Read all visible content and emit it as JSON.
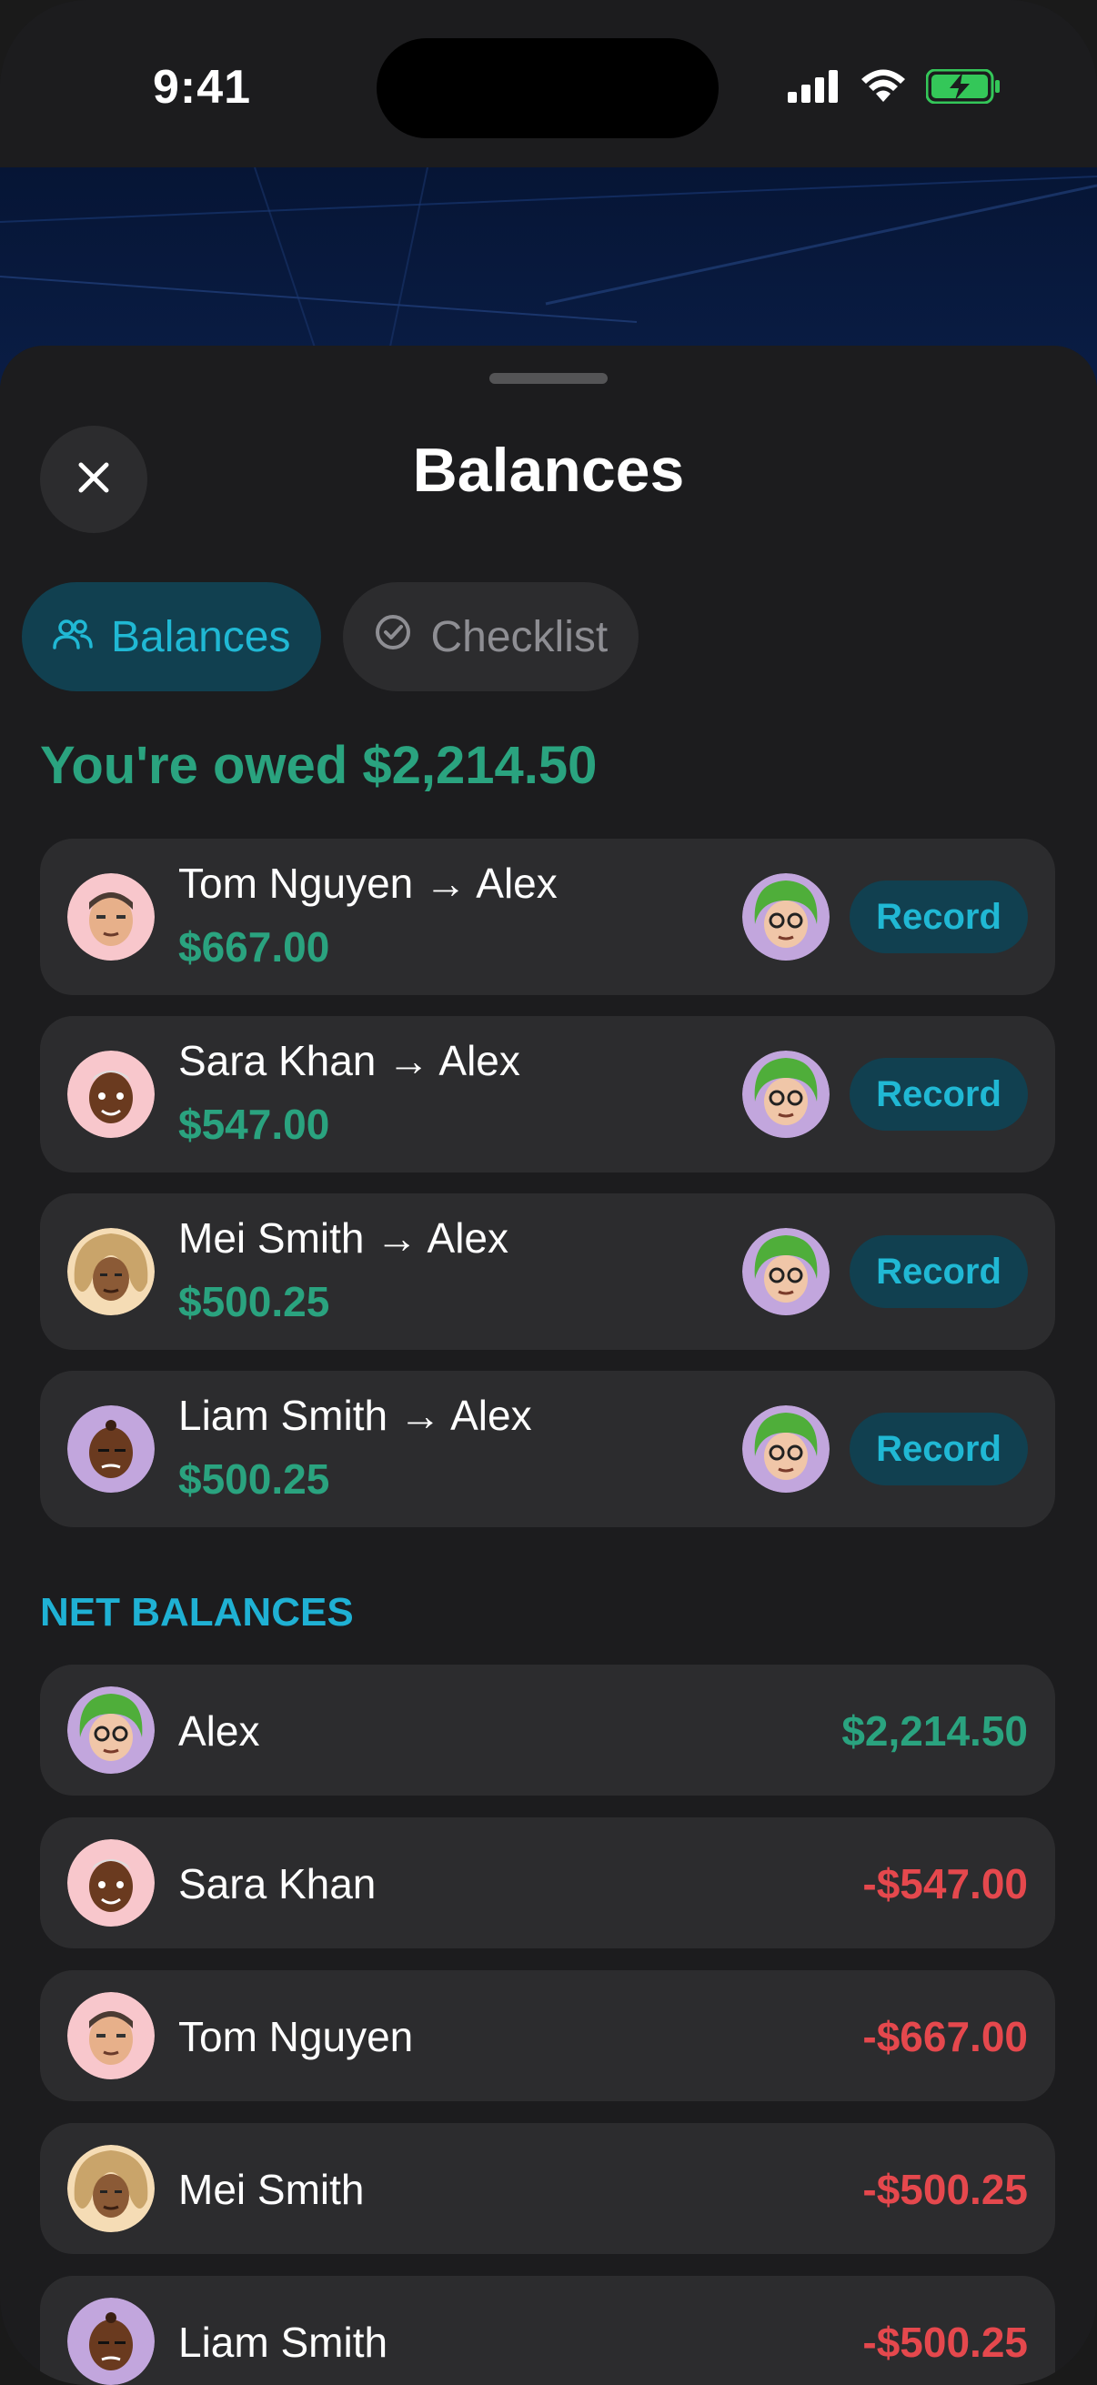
{
  "status_bar": {
    "time": "9:41"
  },
  "sheet": {
    "title": "Balances",
    "tabs": [
      {
        "label": "Balances",
        "active": true
      },
      {
        "label": "Checklist",
        "active": false
      }
    ],
    "owed_summary": "You're owed $2,214.50",
    "settlements": [
      {
        "from": "Tom Nguyen",
        "to": "Alex",
        "names": "Tom Nguyen → Alex",
        "amount": "$667.00",
        "action": "Record"
      },
      {
        "from": "Sara Khan",
        "to": "Alex",
        "names": "Sara Khan → Alex",
        "amount": "$547.00",
        "action": "Record"
      },
      {
        "from": "Mei Smith",
        "to": "Alex",
        "names": "Mei Smith → Alex",
        "amount": "$500.25",
        "action": "Record"
      },
      {
        "from": "Liam Smith",
        "to": "Alex",
        "names": "Liam Smith → Alex",
        "amount": "$500.25",
        "action": "Record"
      }
    ],
    "net_title": "NET BALANCES",
    "net_balances": [
      {
        "name": "Alex",
        "amount": "$2,214.50",
        "sign": "positive"
      },
      {
        "name": "Sara Khan",
        "amount": "-$547.00",
        "sign": "negative"
      },
      {
        "name": "Tom Nguyen",
        "amount": "-$667.00",
        "sign": "negative"
      },
      {
        "name": "Mei Smith",
        "amount": "-$500.25",
        "sign": "negative"
      },
      {
        "name": "Liam Smith",
        "amount": "-$500.25",
        "sign": "negative"
      }
    ]
  },
  "colors": {
    "accent_teal": "#20b8d4",
    "positive_green": "#2aa37f",
    "negative_red": "#e5484d",
    "card_bg": "#2c2c2e",
    "sheet_bg": "#1c1c1e"
  },
  "icons": {
    "close": "close-icon",
    "balances_tab": "people-icon",
    "checklist_tab": "check-circle-icon",
    "signal": "cellular-signal-icon",
    "wifi": "wifi-icon",
    "battery": "battery-charging-icon"
  }
}
